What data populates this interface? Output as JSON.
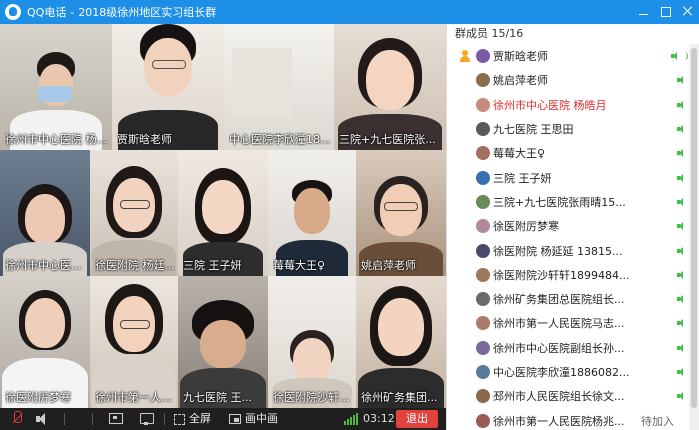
{
  "window": {
    "app_name": "QQ电话",
    "separator": "-",
    "group_name": "2018级徐州地区实习组长群"
  },
  "videos": [
    {
      "caption": "徐州市中心医院 杨..."
    },
    {
      "caption": "贾斯晗老师"
    },
    {
      "caption": "中心医院李欣潼18..."
    },
    {
      "caption": "三院+九七医院张..."
    },
    {
      "caption": "徐州市中心医..."
    },
    {
      "caption": "徐医附院  杨廷..."
    },
    {
      "caption": "三院 王子妍"
    },
    {
      "caption": "莓莓大王♀"
    },
    {
      "caption": "姚启萍老师"
    },
    {
      "caption": "徐医附厉梦寒"
    },
    {
      "caption": "徐州市第一人..."
    },
    {
      "caption": "九七医院     王..."
    },
    {
      "caption": "徐医附院沙轩..."
    },
    {
      "caption": "徐州矿务集团..."
    }
  ],
  "toolbar": {
    "fullscreen_label": "全屏",
    "pip_label": "画中画",
    "call_time": "03:12",
    "hangup_label": "退出"
  },
  "panel": {
    "header": "群成员 15/16",
    "waiting_label": "待加入",
    "members": [
      {
        "name": "贾斯晗老师",
        "avatar_color": "#7a5aa8"
      },
      {
        "name": "姚启萍老师",
        "avatar_color": "#8c6b4a"
      },
      {
        "name": "徐州市中心医院 杨皓月",
        "avatar_color": "#c98b7a"
      },
      {
        "name": "九七医院     王思田",
        "avatar_color": "#5a5a5a"
      },
      {
        "name": "莓莓大王♀",
        "avatar_color": "#a07060"
      },
      {
        "name": "三院 王子妍",
        "avatar_color": "#3a6fb0"
      },
      {
        "name": "三院+九七医院张雨晴15...",
        "avatar_color": "#6a8a5a"
      },
      {
        "name": "徐医附厉梦寒",
        "avatar_color": "#b08a9a"
      },
      {
        "name": "徐医附院  杨延延  13815...",
        "avatar_color": "#4a4a6a"
      },
      {
        "name": "徐医附院沙轩轩1899484...",
        "avatar_color": "#9a7a5a"
      },
      {
        "name": "徐州矿务集团总医院组长...",
        "avatar_color": "#6a6a6a"
      },
      {
        "name": "徐州市第一人民医院马志...",
        "avatar_color": "#aa7a6a"
      },
      {
        "name": "徐州市中心医院副组长孙...",
        "avatar_color": "#7a6a9a"
      },
      {
        "name": "中心医院李欣潼1886082...",
        "avatar_color": "#5a7a9a"
      },
      {
        "name": "邳州市人民医院组长徐文...",
        "avatar_color": "#8a6a4a"
      },
      {
        "name": "徐州市第一人民医院杨兆...",
        "avatar_color": "#9a5a5a"
      }
    ]
  }
}
